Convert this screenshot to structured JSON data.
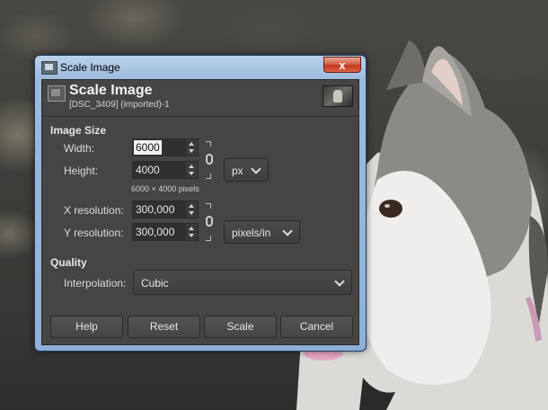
{
  "window": {
    "title": "Scale Image",
    "close_glyph": "x"
  },
  "header": {
    "title": "Scale Image",
    "subtitle": "[DSC_3409] (imported)-1",
    "icon": "scale-image-icon"
  },
  "image_size": {
    "section_label": "Image Size",
    "width_label": "Width:",
    "width_value": "6000",
    "height_label": "Height:",
    "height_value": "4000",
    "unit_value": "px",
    "pixels_note": "6000 × 4000 pixels",
    "x_res_label": "X resolution:",
    "x_res_value": "300,000",
    "y_res_label": "Y resolution:",
    "y_res_value": "300,000",
    "res_unit_value": "pixels/in"
  },
  "quality": {
    "section_label": "Quality",
    "interpolation_label": "Interpolation:",
    "interpolation_value": "Cubic"
  },
  "buttons": {
    "help": "Help",
    "reset": "Reset",
    "scale": "Scale",
    "cancel": "Cancel"
  },
  "colors": {
    "dialog_bg": "#454545",
    "window_frame": "#8fb0d6",
    "close_button": "#c2371f"
  }
}
